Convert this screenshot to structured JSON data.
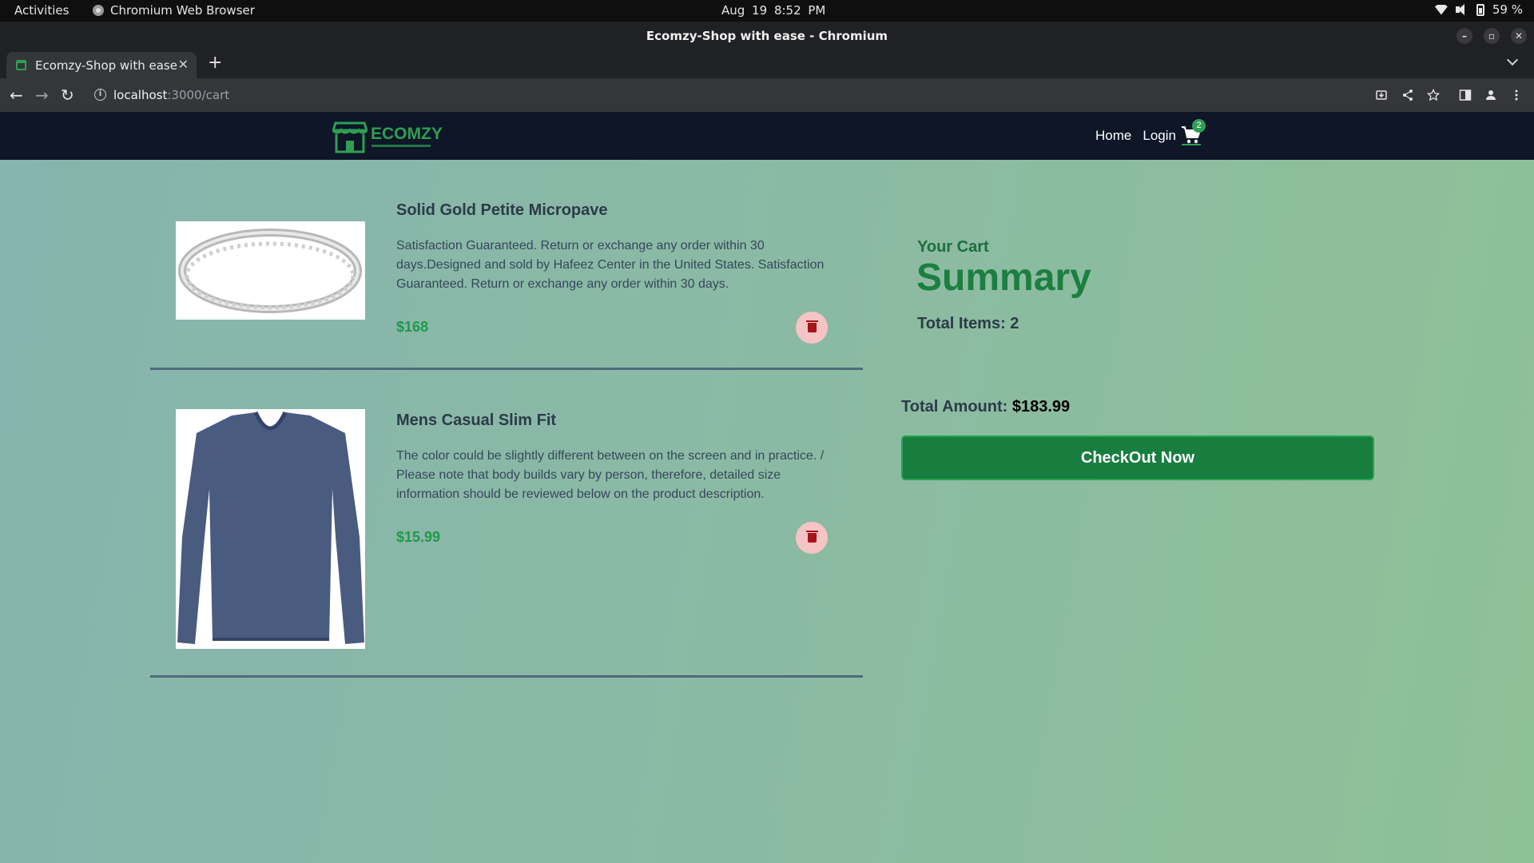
{
  "system": {
    "activities": "Activities",
    "app_name": "Chromium Web Browser",
    "date": "Aug 19",
    "time": "8:52 PM",
    "battery": "59 %"
  },
  "window": {
    "title": "Ecomzy-Shop with ease - Chromium"
  },
  "tabs": [
    {
      "label": "Ecomzy-Shop with ease",
      "active": true
    }
  ],
  "address_bar": {
    "host": "localhost",
    "path": ":3000/cart"
  },
  "navbar": {
    "brand": "ECOMZY",
    "links": [
      "Home",
      "Login"
    ],
    "cart_count": "2"
  },
  "cart_items": [
    {
      "name": "Solid Gold Petite Micropave",
      "description": "Satisfaction Guaranteed. Return or exchange any order within 30 days.Designed and sold by Hafeez Center in the United States. Satisfaction Guaranteed. Return or exchange any order within 30 days.",
      "price": "$168",
      "image": "ring"
    },
    {
      "name": "Mens Casual Slim Fit",
      "description": "The color could be slightly different between on the screen and in practice. / Please note that body builds vary by person, therefore, detailed size information should be reviewed below on the product description.",
      "price": "$15.99",
      "image": "shirt"
    }
  ],
  "summary": {
    "your_cart": "Your Cart",
    "heading": "Summary",
    "total_items": "Total Items: 2",
    "total_amount_label": "Total Amount:",
    "total_amount_value": "$183.99",
    "checkout_label": "CheckOut Now"
  },
  "colors": {
    "navbar_bg": "#0e1627",
    "accent_green": "#177e3f",
    "price_green": "#1f9a4c",
    "delete_bg": "#f6c4c4"
  }
}
